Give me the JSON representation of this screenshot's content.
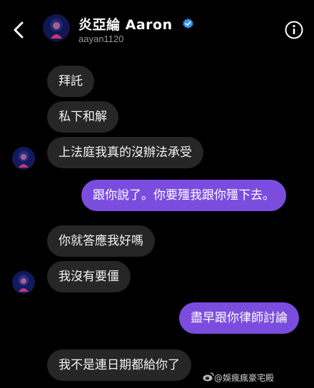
{
  "header": {
    "name": "炎亞綸 Aaron",
    "handle": "aayan1120",
    "back_icon": "chevron-left-icon",
    "verified_icon": "verified-badge-icon",
    "info_icon": "info-icon"
  },
  "messages": [
    {
      "side": "received",
      "text": "拜託"
    },
    {
      "side": "received",
      "text": "私下和解"
    },
    {
      "side": "received",
      "text": "上法庭我真的沒辦法承受"
    },
    {
      "side": "sent",
      "text": "跟你說了。你要殭我跟你殭下去。"
    },
    {
      "side": "received",
      "text": "你就答應我好嗎"
    },
    {
      "side": "received",
      "text": "我沒有要僵"
    },
    {
      "side": "sent",
      "text": "盡早跟你律師討論"
    },
    {
      "side": "received",
      "text": "我不是連日期都給你了"
    }
  ],
  "watermark": {
    "text": "@娛瘋瘋豪宅殿"
  },
  "colors": {
    "background": "#000000",
    "received_bubble": "#262626",
    "sent_bubble": "#7b4ddf",
    "verified": "#3897f0"
  }
}
